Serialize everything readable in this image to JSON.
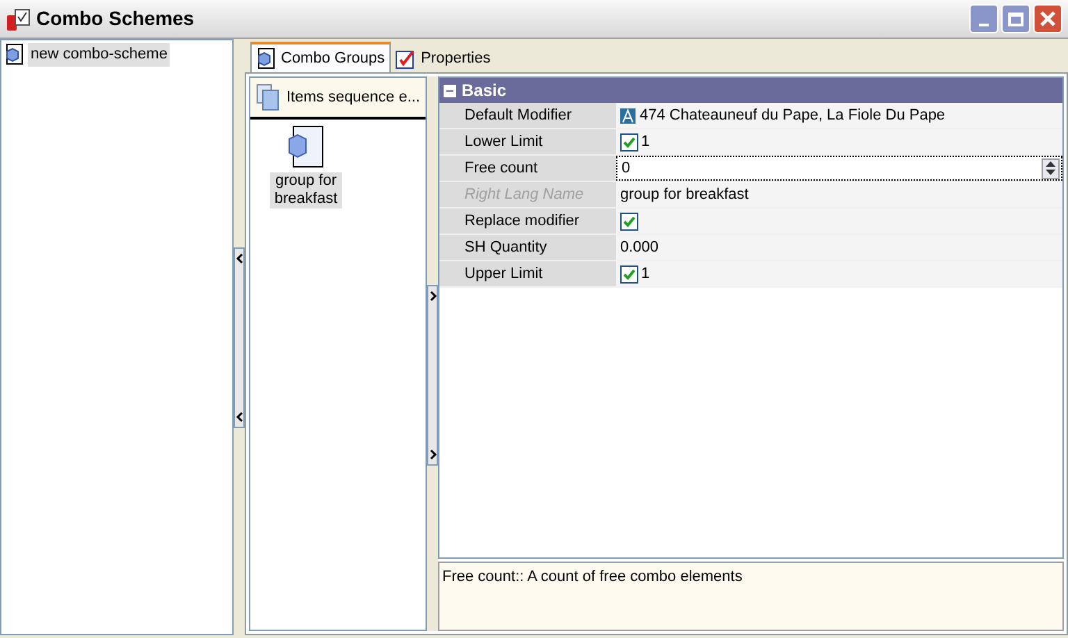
{
  "window": {
    "title": "Combo Schemes"
  },
  "tree": {
    "items": [
      {
        "label": "new combo-scheme",
        "selected": true
      }
    ]
  },
  "tabs": [
    {
      "label": "Combo Groups",
      "selected": true
    },
    {
      "label": "Properties",
      "selected": false
    }
  ],
  "sequence": {
    "header": "Items sequence e...",
    "items": [
      {
        "label": "group for breakfast",
        "selected": true
      }
    ]
  },
  "property_grid": {
    "category": {
      "label": "Basic",
      "expanded": true
    },
    "rows": [
      {
        "name": "Default Modifier",
        "kind": "modifier",
        "value": "474 Chateauneuf du Pape, La Fiole Du Pape",
        "disabled": false
      },
      {
        "name": "Lower Limit",
        "kind": "check",
        "checked": true,
        "value": "1",
        "disabled": false
      },
      {
        "name": "Free count",
        "kind": "spin",
        "value": "0",
        "disabled": false,
        "selected": true
      },
      {
        "name": "Right Lang Name",
        "kind": "text",
        "value": "group for breakfast",
        "disabled": true
      },
      {
        "name": "Replace modifier",
        "kind": "check",
        "checked": true,
        "disabled": false
      },
      {
        "name": "SH Quantity",
        "kind": "text",
        "value": "0.000",
        "disabled": false
      },
      {
        "name": "Upper Limit",
        "kind": "check",
        "checked": true,
        "value": "1",
        "disabled": false
      }
    ]
  },
  "description": "Free count:: A count of free combo elements"
}
